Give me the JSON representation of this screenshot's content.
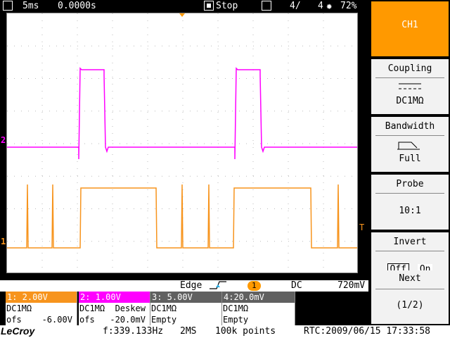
{
  "topbar": {
    "timebase": "5ms",
    "delay": "0.0000s",
    "run_state": "Stop",
    "acq_count": "4/",
    "acq_total": "4",
    "battery": "72%"
  },
  "markers": {
    "ch1": "1",
    "ch2": "2",
    "trigger_level": "T"
  },
  "trigger": {
    "type": "Edge",
    "source": "1",
    "coupling": "DC",
    "level": "720mV"
  },
  "channels": [
    {
      "header": "1: 2.00V",
      "color": "#f7941d",
      "row1": "DC1MΩ",
      "row2": "ofs    -6.00V"
    },
    {
      "header": "2: 1.00V",
      "color": "#ff00ff",
      "row1": "DC1MΩ  Deskew",
      "row2": "ofs   -20.0mV"
    },
    {
      "header": "3: 5.00V",
      "color": "#606060",
      "row1": "DC1MΩ",
      "row2": "Empty"
    },
    {
      "header": "4:20.0mV",
      "color": "#606060",
      "row1": "DC1MΩ",
      "row2": "Empty"
    }
  ],
  "bottombar": {
    "logo": "LeCroy",
    "frequency": "f:339.133Hz",
    "sample_rate": "2MS",
    "record_length": "100k points",
    "rtc": "RTC:2009/06/15 17:33:58"
  },
  "menu": {
    "channel": "CH1",
    "coupling_title": "Coupling",
    "coupling_value": "DC1MΩ",
    "bandwidth_title": "Bandwidth",
    "bandwidth_value": "Full",
    "probe_title": "Probe",
    "probe_value": "10:1",
    "invert_title": "Invert",
    "invert_off": "Off",
    "invert_on": "On",
    "next_title": "Next",
    "next_value": "(1/2)"
  },
  "colors": {
    "ch1": "#f7941d",
    "ch2": "#ff00ff",
    "accent": "#ff9900"
  }
}
